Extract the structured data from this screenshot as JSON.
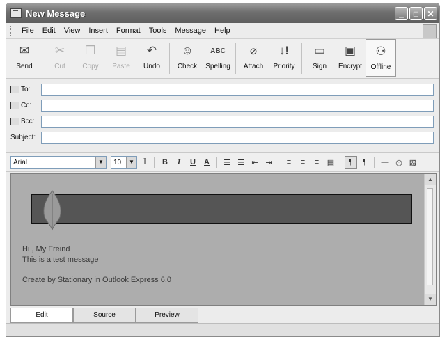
{
  "window": {
    "title": "New Message"
  },
  "menu": {
    "items": [
      {
        "label": "File"
      },
      {
        "label": "Edit"
      },
      {
        "label": "View"
      },
      {
        "label": "Insert"
      },
      {
        "label": "Format"
      },
      {
        "label": "Tools"
      },
      {
        "label": "Message"
      },
      {
        "label": "Help"
      }
    ]
  },
  "toolbar": {
    "buttons": [
      {
        "label": "Send",
        "icon": "send-icon"
      },
      {
        "label": "Cut",
        "icon": "scissors-icon"
      },
      {
        "label": "Copy",
        "icon": "copy-icon"
      },
      {
        "label": "Paste",
        "icon": "paste-icon"
      },
      {
        "label": "Undo",
        "icon": "undo-icon"
      },
      {
        "label": "Check",
        "icon": "check-names-icon"
      },
      {
        "label": "Spelling",
        "icon": "spelling-icon"
      },
      {
        "label": "Attach",
        "icon": "paperclip-icon"
      },
      {
        "label": "Priority",
        "icon": "priority-icon"
      },
      {
        "label": "Sign",
        "icon": "sign-icon"
      },
      {
        "label": "Encrypt",
        "icon": "encrypt-icon"
      },
      {
        "label": "Offline",
        "icon": "offline-icon"
      }
    ]
  },
  "fields": {
    "to": {
      "label": "To:",
      "value": ""
    },
    "cc": {
      "label": "Cc:",
      "value": ""
    },
    "bcc": {
      "label": "Bcc:",
      "value": ""
    },
    "subject": {
      "label": "Subject:",
      "value": ""
    }
  },
  "format": {
    "font": "Arial",
    "size": "10"
  },
  "message": {
    "line1": "Hi , My Freind",
    "line2": "This is a test message",
    "line3": "Create by Stationary in Outlook Express 6.0"
  },
  "tabs": [
    {
      "label": "Edit"
    },
    {
      "label": "Source"
    },
    {
      "label": "Preview"
    }
  ]
}
